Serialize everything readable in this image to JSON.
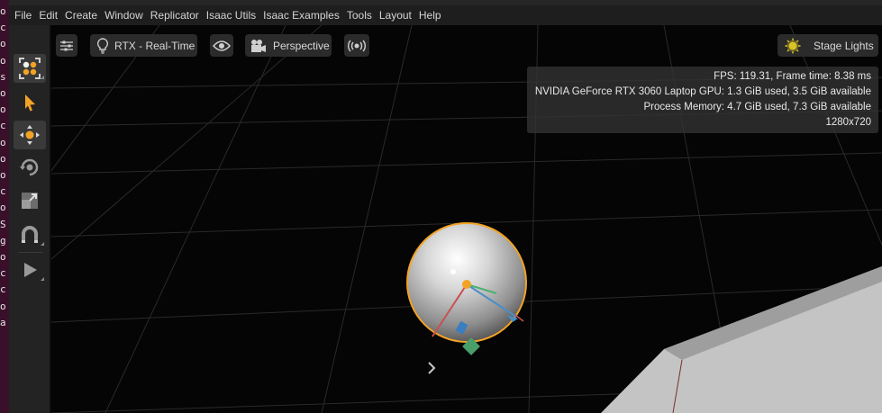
{
  "terminal_strip": {
    "chars": [
      "o",
      "c",
      "o",
      "o",
      "s",
      "o",
      "o",
      "c",
      "o",
      "o",
      "o",
      "c",
      "o",
      "S",
      "g",
      "o",
      "c",
      "c",
      "o",
      "a"
    ]
  },
  "menubar": {
    "items": [
      "File",
      "Edit",
      "Create",
      "Window",
      "Replicator",
      "Isaac Utils",
      "Isaac Examples",
      "Tools",
      "Layout",
      "Help"
    ]
  },
  "toolbar": {
    "tools": [
      {
        "name": "select-mode",
        "icon": "grid-select-icon"
      },
      {
        "name": "select",
        "icon": "pointer-arrow-icon"
      },
      {
        "name": "move",
        "icon": "move-arrows-icon"
      },
      {
        "name": "rotate",
        "icon": "rotate-icon"
      },
      {
        "name": "scale",
        "icon": "scale-icon"
      },
      {
        "name": "snap",
        "icon": "magnet-icon"
      },
      {
        "name": "play",
        "icon": "play-icon"
      }
    ]
  },
  "viewport": {
    "settings_icon": "sliders-icon",
    "render_mode_label": "RTX - Real-Time",
    "render_mode_icon": "lightbulb-icon",
    "visibility_icon": "eye-icon",
    "camera_label": "Perspective",
    "camera_icon": "camera-icon",
    "broadcast_icon": "broadcast-icon",
    "lights_label": "Stage Lights",
    "lights_icon": "sun-icon",
    "accent_color": "#f2a325"
  },
  "stats": {
    "fps_line": "FPS: 119.31, Frame time: 8.38 ms",
    "gpu_line": "NVIDIA GeForce RTX 3060 Laptop GPU: 1.3 GiB used, 3.5 GiB available",
    "memory_line": "Process Memory: 4.7 GiB used, 7.3 GiB available",
    "resolution_line": "1280x720"
  }
}
